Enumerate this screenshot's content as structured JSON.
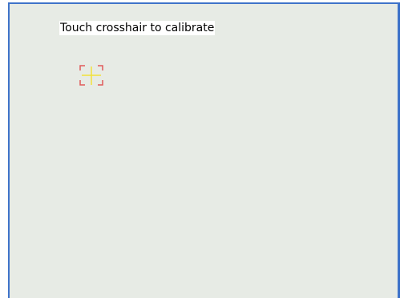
{
  "calibration": {
    "instruction": "Touch crosshair to calibrate",
    "target_icon": "crosshair-icon"
  },
  "colors": {
    "background": "#e7ebe5",
    "frame_border": "#3f73c9",
    "bracket": "#e05a5a",
    "crosshair": "#f2e23a"
  }
}
